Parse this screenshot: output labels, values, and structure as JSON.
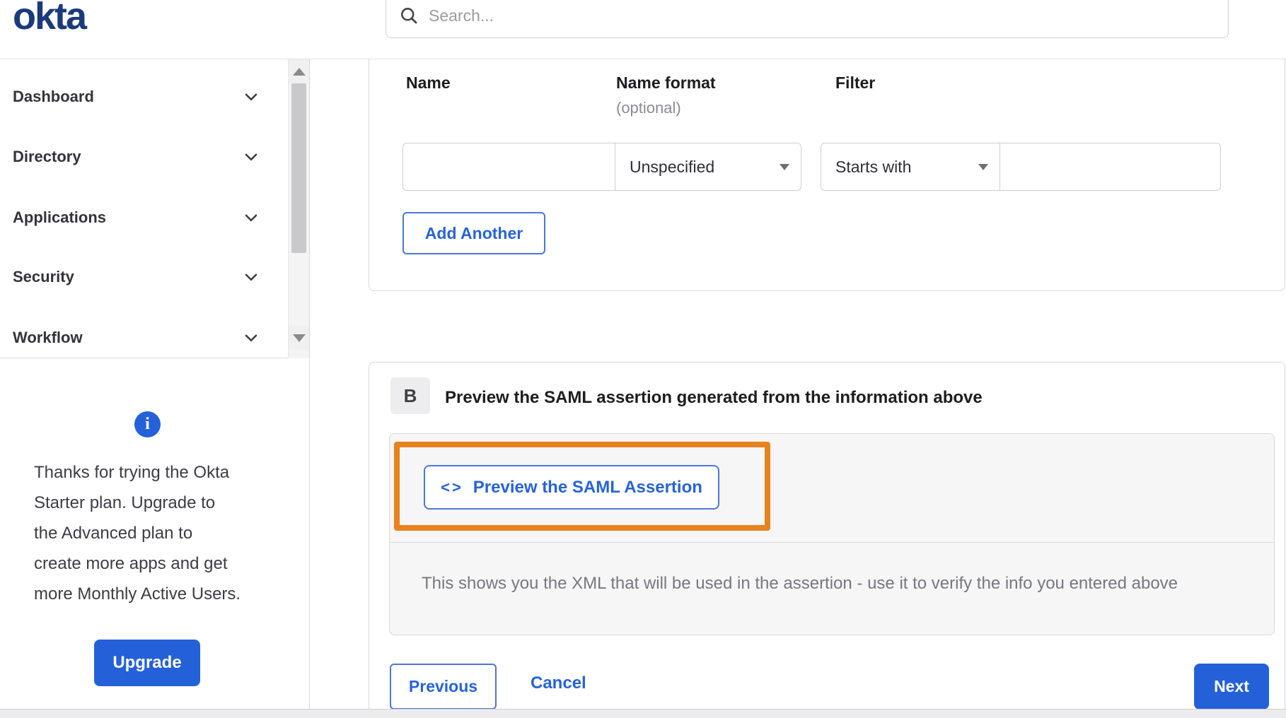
{
  "header": {
    "logo": "okta",
    "search_placeholder": "Search..."
  },
  "sidebar": {
    "items": [
      {
        "label": "Dashboard"
      },
      {
        "label": "Directory"
      },
      {
        "label": "Applications"
      },
      {
        "label": "Security"
      },
      {
        "label": "Workflow"
      }
    ],
    "upgrade": {
      "info_icon": "i",
      "message_lines": [
        "Thanks for trying the Okta",
        "Starter plan. Upgrade to",
        "the Advanced plan to",
        "create more apps and get",
        "more Monthly Active Users."
      ],
      "button_label": "Upgrade"
    }
  },
  "attribute_form": {
    "columns": {
      "name": "Name",
      "name_format": "Name format",
      "name_format_note": "(optional)",
      "filter": "Filter"
    },
    "row": {
      "name_value": "",
      "name_format_value": "Unspecified",
      "filter_type_value": "Starts with",
      "filter_value": ""
    },
    "add_another_label": "Add Another"
  },
  "preview_section": {
    "badge": "B",
    "heading": "Preview the SAML assertion generated from the information above",
    "button_icon": "<>",
    "button_label": "Preview the SAML Assertion",
    "description": "This shows you the XML that will be used in the assertion - use it to verify the info you entered above"
  },
  "footer": {
    "previous_label": "Previous",
    "cancel_label": "Cancel",
    "next_label": "Next"
  },
  "colors": {
    "accent_blue": "#2461d9",
    "link_blue": "#2563db",
    "logo_navy": "#1a3a7c",
    "highlight_orange": "#e8821f",
    "panel_gray": "#f6f6f7"
  }
}
